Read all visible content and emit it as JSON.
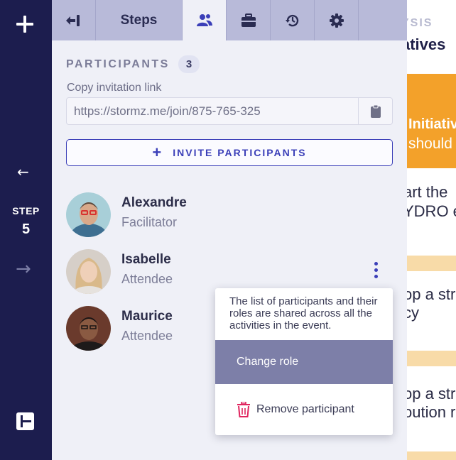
{
  "rail": {
    "step_label": "STEP",
    "step_number": "5",
    "icons": [
      "plus-icon",
      "back-arrow-icon",
      "forward-arrow-icon",
      "layout-icon"
    ]
  },
  "tabs": {
    "steps_label": "Steps",
    "icons": [
      "collapse-panel-icon",
      "participants-icon",
      "briefcase-icon",
      "history-icon",
      "settings-icon"
    ],
    "active": "participants"
  },
  "participants": {
    "title": "PARTICIPANTS",
    "count": "3",
    "copy_label": "Copy invitation link",
    "invitation_link": "https://stormz.me/join/875-765-325",
    "invite_button": "INVITE PARTICIPANTS",
    "list": [
      {
        "name": "Alexandre",
        "role": "Facilitator"
      },
      {
        "name": "Isabelle",
        "role": "Attendee"
      },
      {
        "name": "Maurice",
        "role": "Attendee"
      }
    ]
  },
  "popup": {
    "info": "The list of participants and their roles are shared across all the activities in the event.",
    "change_role": "Change role",
    "remove_participant": "Remove participant"
  },
  "background": {
    "line1": "YSIS",
    "line2": "atives",
    "orange_line1": "Initiativ",
    "orange_line2": "should",
    "line3": "art the",
    "line4": "YDRO e",
    "line5": "op a str",
    "line6": "cy",
    "line7": "op a str",
    "line8": "oution r"
  },
  "colors": {
    "rail": "#1c1d4e",
    "accent": "#3b3fb8",
    "tabbar": "#b8bad9",
    "panel": "#eff0f7",
    "menu_highlight": "#7d7fa8",
    "orange": "#f3a12a",
    "danger": "#e0245e"
  }
}
